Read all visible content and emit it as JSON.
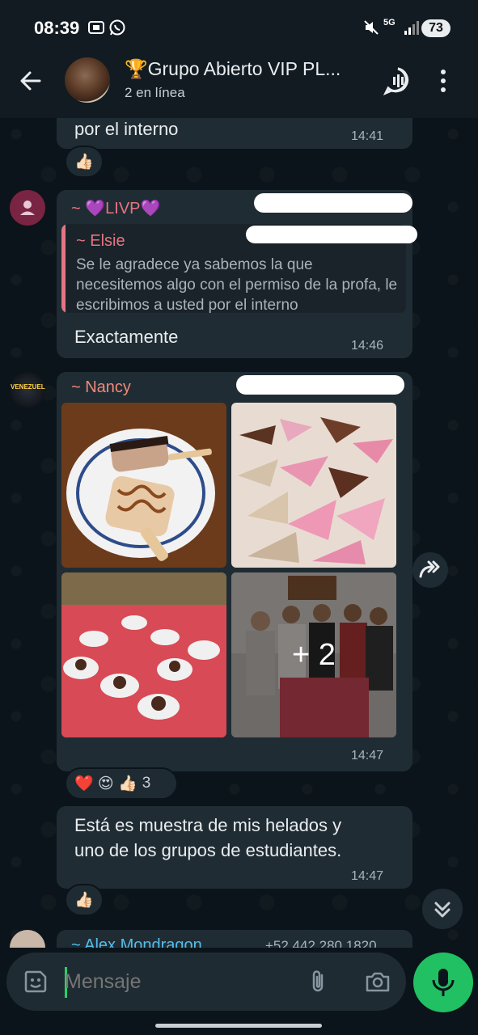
{
  "status_bar": {
    "time": "08:39",
    "network": "5G",
    "battery": "73"
  },
  "header": {
    "title": "🏆Grupo Abierto VIP PL...",
    "subtitle": "2 en línea"
  },
  "messages": [
    {
      "text": "por el interno",
      "time": "14:41",
      "reaction": "👍🏻"
    },
    {
      "sender": "~ 💜LIVP💜",
      "quote_sender": "~ Elsie",
      "quote_text": "Se le agradece ya sabemos la que necesitemos algo con el permiso de la profa, le escribimos a usted por el interno",
      "text": "Exactamente",
      "time": "14:46"
    },
    {
      "sender": "~ Nancy",
      "avatar_label": "VENEZUELA",
      "more_count": "+ 2",
      "time": "14:47",
      "reactions": "❤️ 😍 👍🏻",
      "reactions_count": "3"
    },
    {
      "text_line1": "Está es muestra de mis helados y",
      "text_line2": "uno de los grupos de estudiantes.",
      "time": "14:47",
      "reaction": "👍🏻"
    },
    {
      "sender": "~ Alex Mondragon",
      "phone": "+52 442 280 1820"
    }
  ],
  "input": {
    "placeholder": "Mensaje"
  },
  "colors": {
    "accent": "#25d366",
    "bubble": "#202c33",
    "livp_name": "#e57583",
    "nancy_name": "#f08a7a",
    "alex_name": "#53bdeb"
  }
}
